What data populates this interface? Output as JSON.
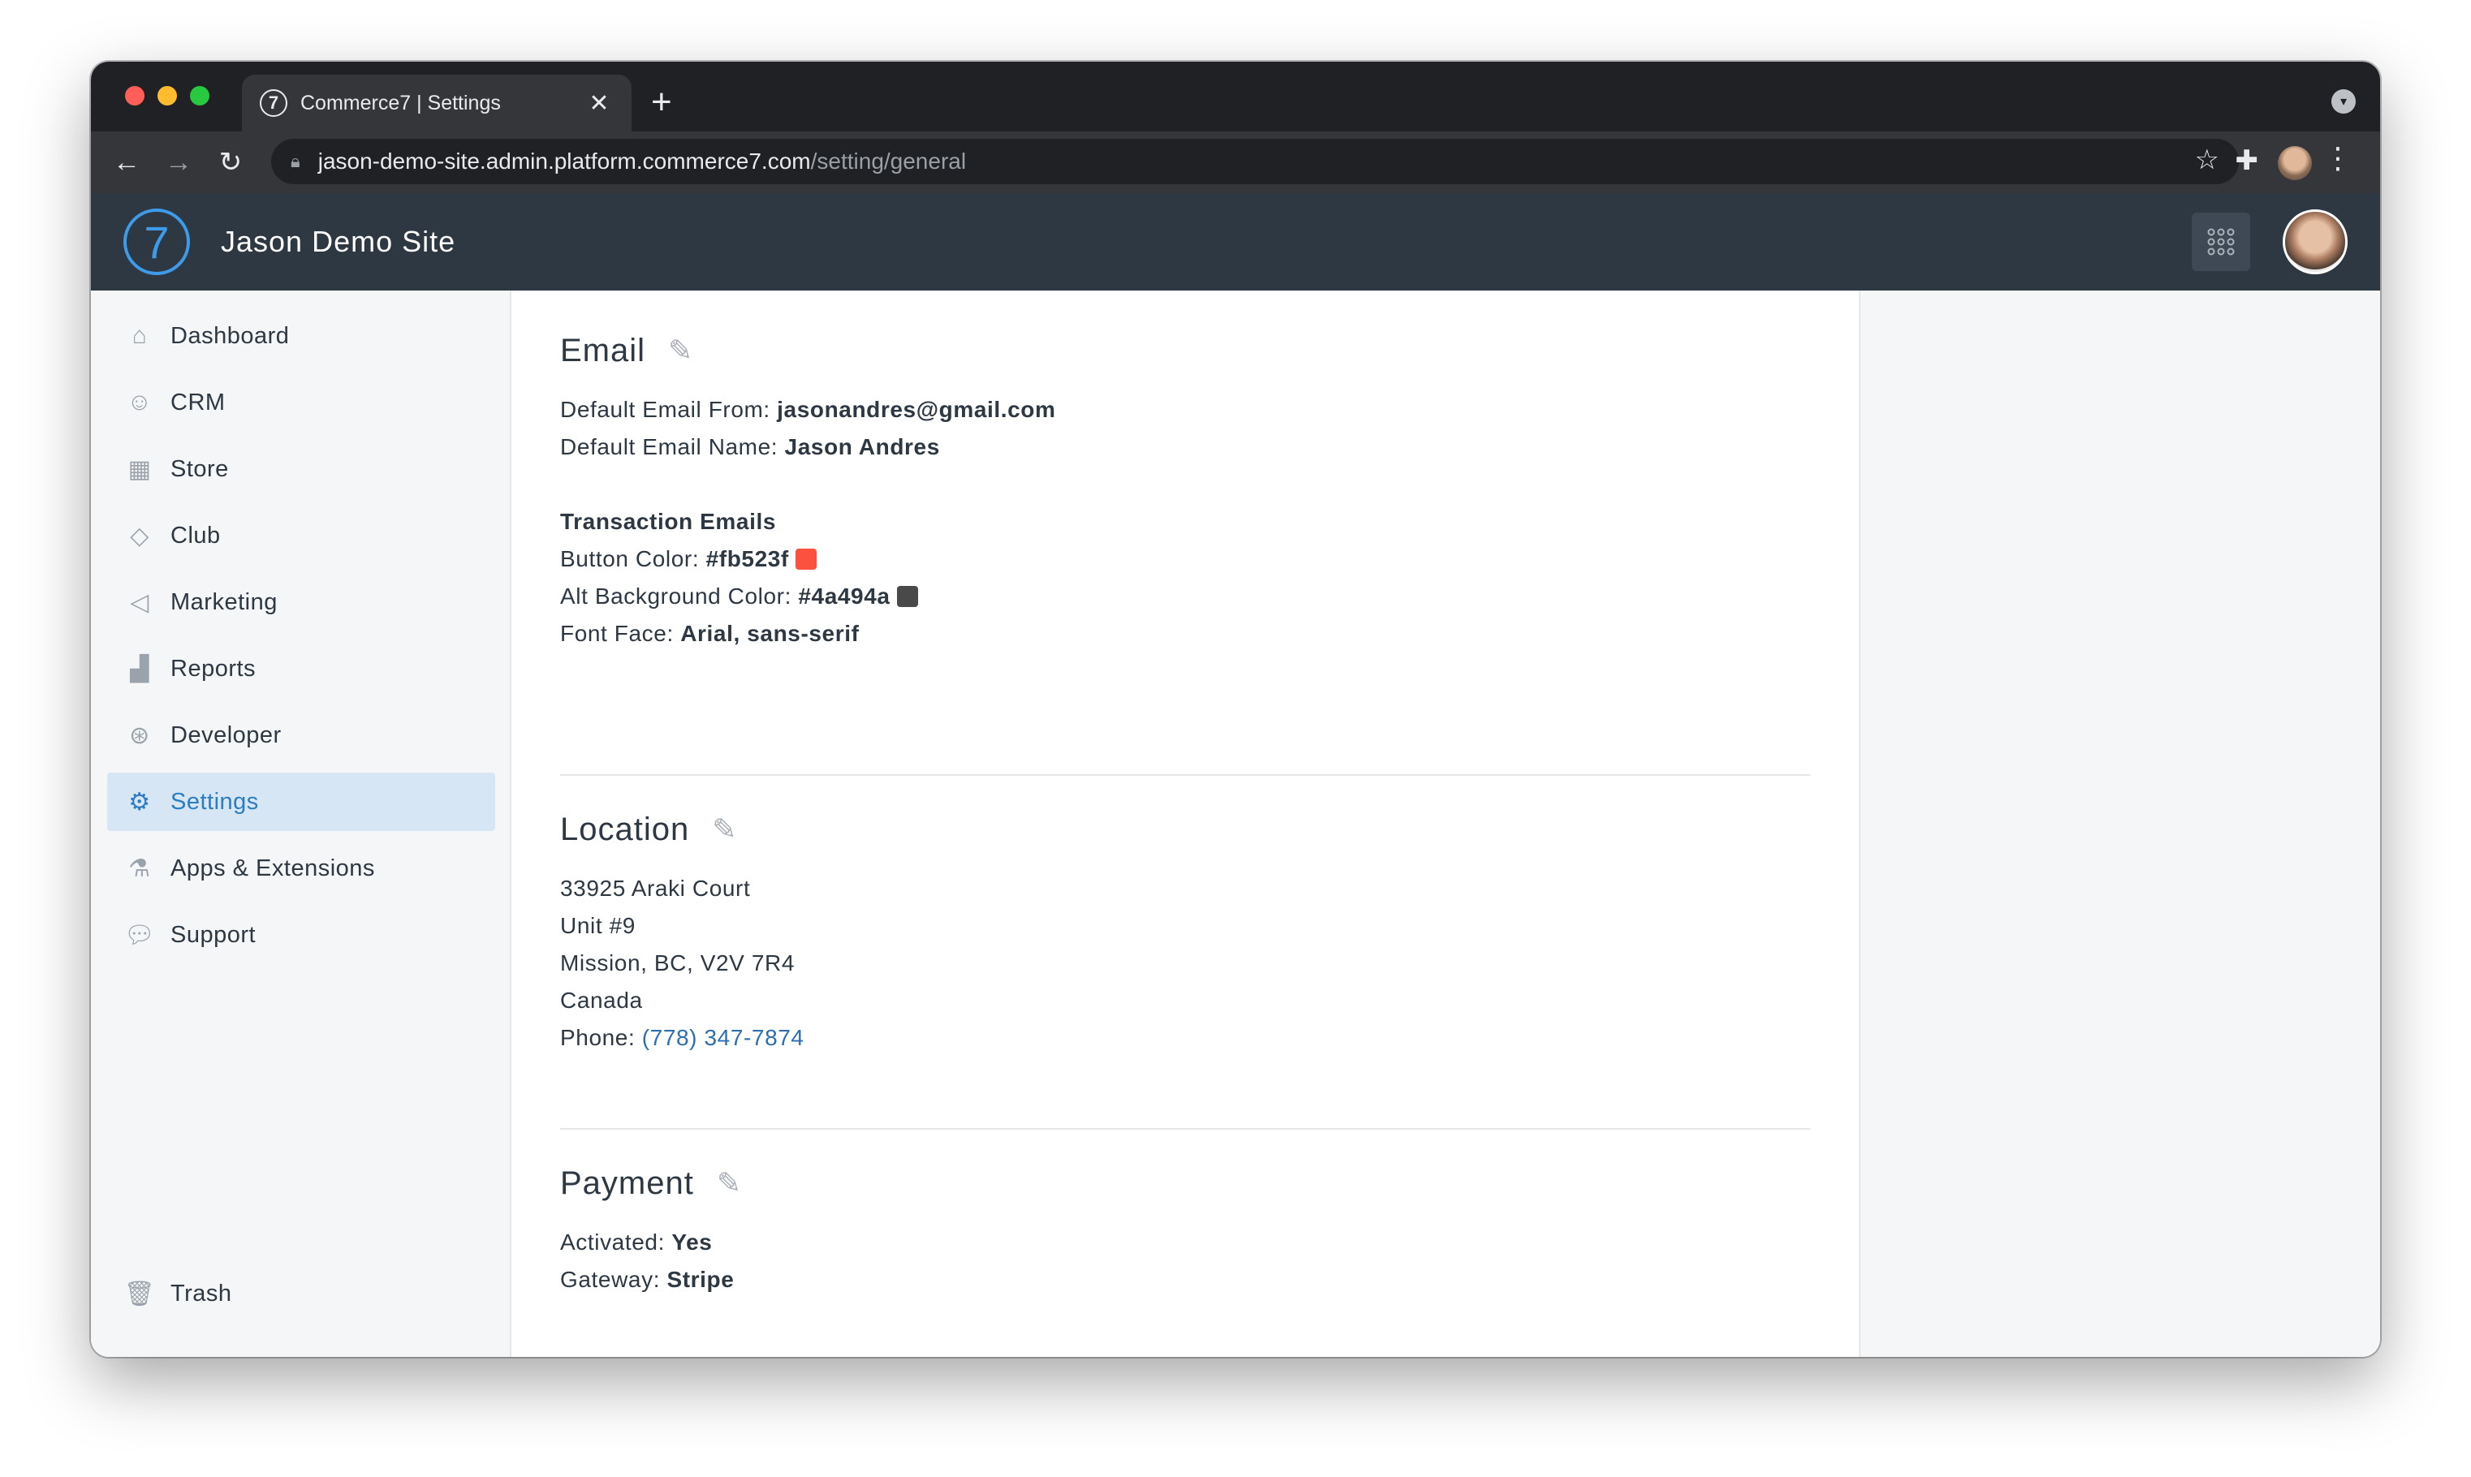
{
  "browser": {
    "tab_title": "Commerce7 | Settings",
    "tab_favicon": "7",
    "tab_close": "✕",
    "new_tab": "+",
    "url_host": "jason-demo-site.admin.platform.commerce7.com",
    "url_path": "/setting/general"
  },
  "header": {
    "logo_glyph": "7",
    "site_name": "Jason Demo Site",
    "apps_icon": "⋮⋮⋮"
  },
  "sidebar": {
    "items": [
      {
        "label": "Dashboard",
        "icon": "home-icon"
      },
      {
        "label": "CRM",
        "icon": "smile-icon"
      },
      {
        "label": "Store",
        "icon": "store-icon"
      },
      {
        "label": "Club",
        "icon": "diamond-icon"
      },
      {
        "label": "Marketing",
        "icon": "megaphone-icon"
      },
      {
        "label": "Reports",
        "icon": "bar-chart-icon"
      },
      {
        "label": "Developer",
        "icon": "aperture-icon"
      },
      {
        "label": "Settings",
        "icon": "gear-icon",
        "active": true
      },
      {
        "label": "Apps & Extensions",
        "icon": "flask-icon"
      },
      {
        "label": "Support",
        "icon": "chat-icon"
      }
    ],
    "trash": {
      "label": "Trash",
      "icon": "trash-icon"
    }
  },
  "email": {
    "title": "Email",
    "from_label": "Default Email From: ",
    "from_value": "jasonandres@gmail.com",
    "name_label": "Default Email Name: ",
    "name_value": "Jason Andres",
    "transaction_heading": "Transaction Emails",
    "button_color_label": "Button Color: ",
    "button_color_value": "#fb523f",
    "alt_bg_label": "Alt Background Color: ",
    "alt_bg_value": "#4a494a",
    "font_label": "Font Face: ",
    "font_value": "Arial, sans-serif"
  },
  "location": {
    "title": "Location",
    "line1": "33925 Araki Court",
    "line2": "Unit #9",
    "line3": "Mission, BC, V2V 7R4",
    "line4": "Canada",
    "phone_label": "Phone: ",
    "phone_value": "(778) 347-7874"
  },
  "payment": {
    "title": "Payment",
    "activated_label": "Activated: ",
    "activated_value": "Yes",
    "gateway_label": "Gateway: ",
    "gateway_value": "Stripe"
  },
  "colors": {
    "header_bg": "#2d3843",
    "accent": "#2b7dc2",
    "button_swatch": "#fb523f",
    "alt_bg_swatch": "#4a494a"
  }
}
